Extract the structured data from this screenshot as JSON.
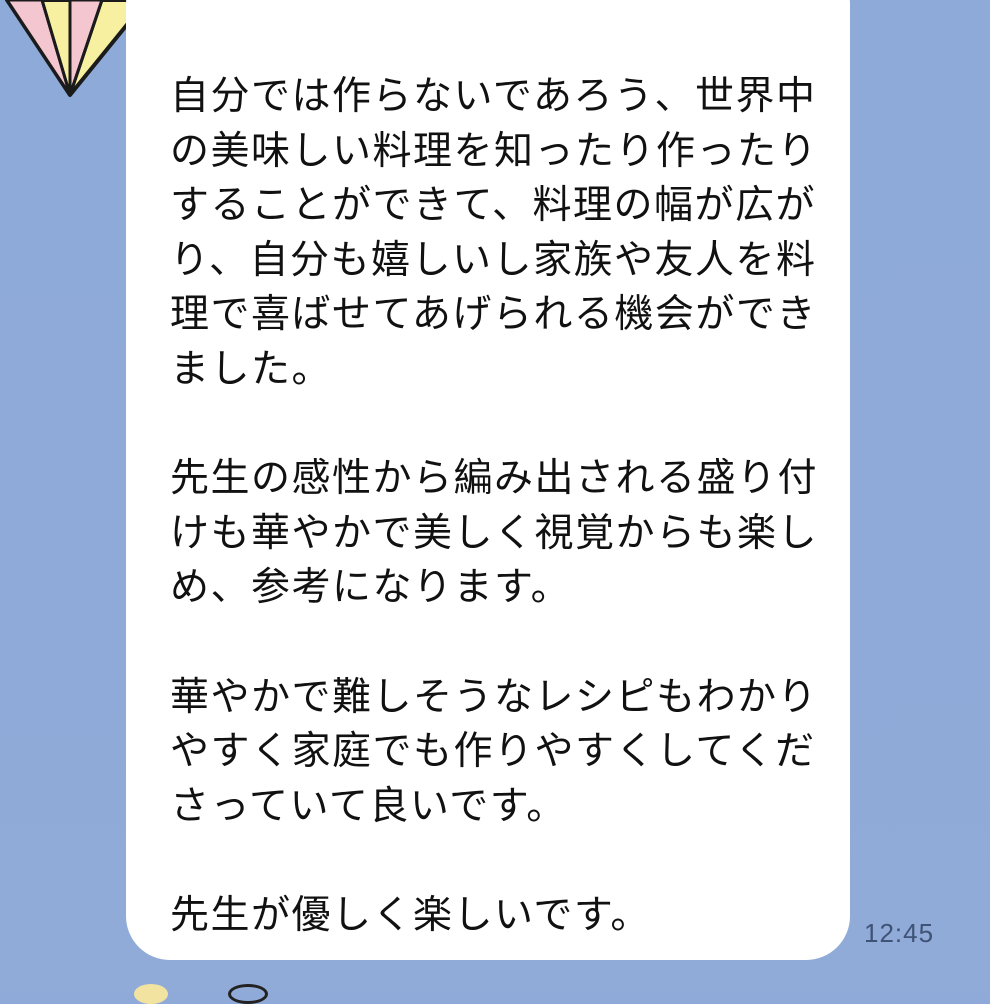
{
  "chat": {
    "message": {
      "text": "自分では作らないであろう、世界中の美味しい料理を知ったり作ったりすることができて、料理の幅が広がり、自分も嬉しいし家族や友人を料理で喜ばせてあげられる機会ができました。\n\n先生の感性から編み出される盛り付けも華やかで美しく視覚からも楽しめ、参考になります。\n\n華やかで難しそうなレシピもわかりやすく家庭でも作りやすくしてくださっていて良いです。\n\n先生が優しく楽しいです。",
      "time": "12:45"
    },
    "colors": {
      "background": "#8faad8",
      "bubble": "#ffffff",
      "text": "#111111",
      "timestamp": "#3f5377"
    },
    "icons": {
      "avatar": "diamond-icon"
    }
  }
}
